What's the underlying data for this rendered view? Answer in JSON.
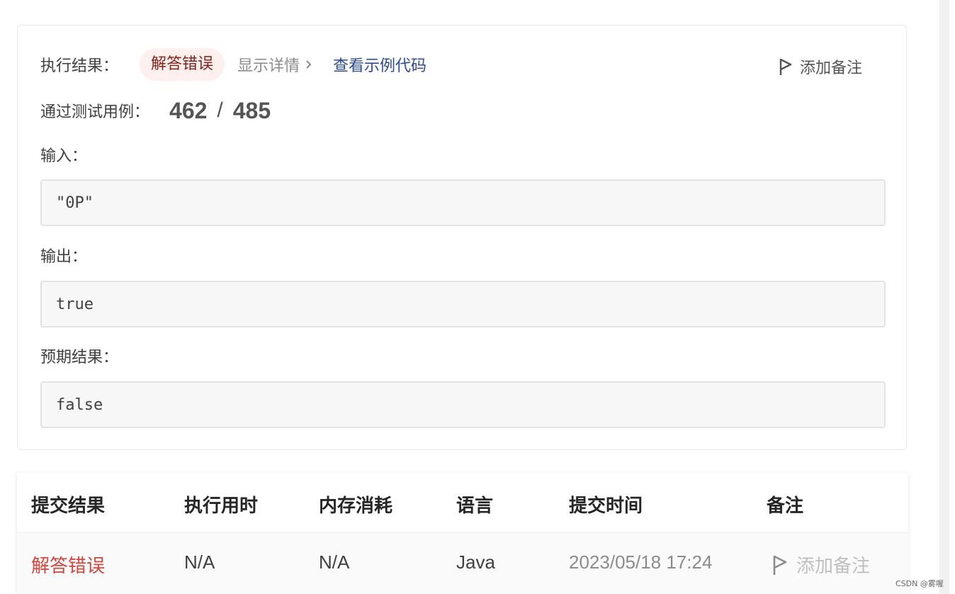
{
  "result": {
    "exec_label": "执行结果：",
    "status": "解答错误",
    "show_details": "显示详情",
    "view_example": "查看示例代码",
    "add_note": "添加备注",
    "pass_label": "通过测试用例：",
    "passed": "462",
    "separator": "/",
    "total": "485",
    "input_label": "输入：",
    "input_value": "\"0P\"",
    "output_label": "输出：",
    "output_value": "true",
    "expected_label": "预期结果：",
    "expected_value": "false"
  },
  "submissions": {
    "headers": [
      "提交结果",
      "执行用时",
      "内存消耗",
      "语言",
      "提交时间",
      "备注"
    ],
    "rows": [
      {
        "status": "解答错误",
        "runtime": "N/A",
        "memory": "N/A",
        "language": "Java",
        "time": "2023/05/18 17:24",
        "note": "添加备注"
      }
    ]
  },
  "watermark": "CSDN @雾喔",
  "colors": {
    "error": "#d9443a",
    "badge_bg": "#fdf0ee",
    "link": "#2b4c9b"
  }
}
